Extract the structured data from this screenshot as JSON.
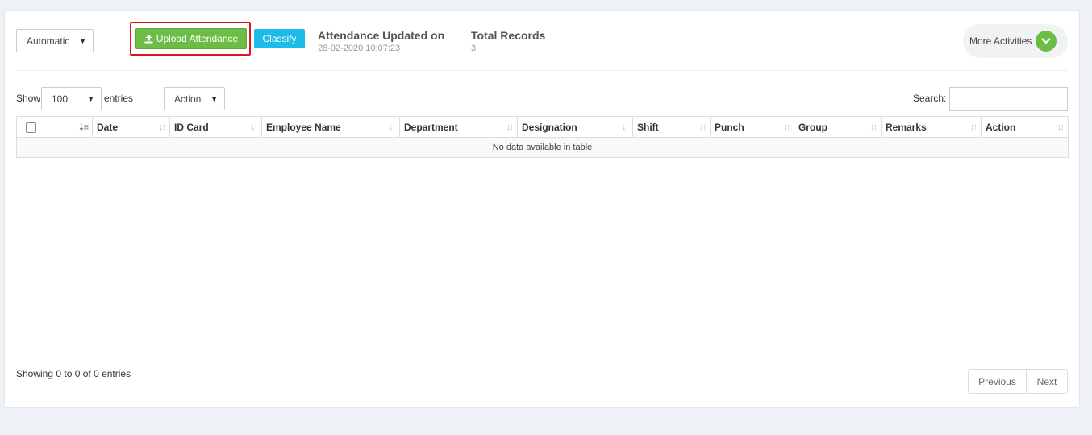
{
  "toolbar": {
    "mode_select": "Automatic",
    "upload_label": "Upload Attendance",
    "classify_label": "Classify",
    "updated_title": "Attendance Updated on",
    "updated_value": "28-02-2020 10:07:23",
    "records_title": "Total Records",
    "records_value": "3",
    "more_label": "More Activities"
  },
  "controls": {
    "show_label": "Show",
    "page_size": "100",
    "entries_label": "entries",
    "action_select": "Action",
    "search_label": "Search:"
  },
  "table": {
    "columns": [
      "Date",
      "ID Card",
      "Employee Name",
      "Department",
      "Designation",
      "Shift",
      "Punch",
      "Group",
      "Remarks",
      "Action"
    ],
    "empty_message": "No data available in table"
  },
  "footer": {
    "info": "Showing 0 to 0 of 0 entries",
    "previous_label": "Previous",
    "next_label": "Next"
  },
  "colors": {
    "upload_button": "#6cbd45",
    "classify_button": "#1cbbe8",
    "highlight_border": "#e0131c",
    "more_icon": "#6cbd45"
  },
  "icons": {
    "upload": "upload-icon",
    "more": "chevron-down-icon",
    "sort": "sort-icon"
  }
}
